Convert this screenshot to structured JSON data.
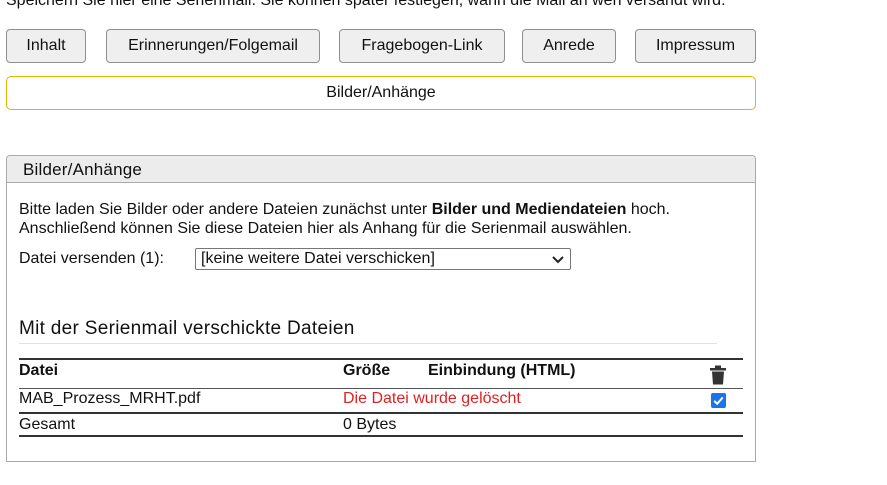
{
  "intro_text": "Speichern Sie hier eine Serienmail. Sie können später festlegen, wann die Mail an wen versandt wird.",
  "tabs": [
    {
      "label": "Inhalt"
    },
    {
      "label": "Erinnerungen/Folgemail"
    },
    {
      "label": "Fragebogen-Link"
    },
    {
      "label": "Anrede"
    },
    {
      "label": "Impressum"
    }
  ],
  "active_tab": {
    "label": "Bilder/Anhänge"
  },
  "panel": {
    "title": "Bilder/Anhänge",
    "desc_part1": "Bitte laden Sie Bilder oder andere Dateien zunächst unter ",
    "desc_bold": "Bilder und Mediendateien",
    "desc_part2": " hoch.",
    "desc_line2": "Anschließend können Sie diese Dateien hier als Anhang für die Serienmail auswählen.",
    "send_label": "Datei versenden (1):",
    "select_value": "[keine weitere Datei verschicken]"
  },
  "files_section": {
    "title": "Mit der Serienmail verschickte Dateien",
    "columns": {
      "file": "Datei",
      "size": "Größe",
      "embed": "Einbindung (HTML)"
    },
    "rows": [
      {
        "file": "MAB_Prozess_MRHT.pdf",
        "status": "Die Datei wurde gelöscht",
        "checked": true
      }
    ],
    "total": {
      "label": "Gesamt",
      "size": "0 Bytes"
    }
  },
  "colors": {
    "accent_border": "#e6b300",
    "error": "#e02020",
    "checkbox": "#1a73e8"
  },
  "icons": {
    "delete": "trash-icon",
    "select": "chevron-down-icon",
    "check": "checkmark-icon"
  }
}
